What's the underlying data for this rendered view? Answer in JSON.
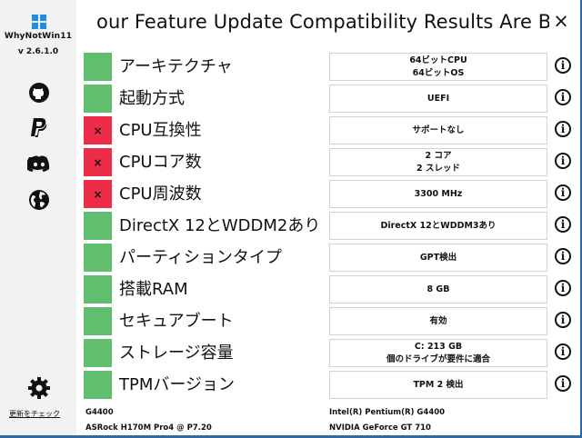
{
  "app": {
    "name": "WhyNotWin11",
    "version": "v 2.6.1.0",
    "update_link": "更新をチェック",
    "brand_color": "#1e8fe6"
  },
  "header": {
    "title": "our Feature Update Compatibility Results Are Belo",
    "close_label": "×"
  },
  "sidebar_icons": [
    "github-icon",
    "paypal-icon",
    "discord-icon",
    "globe-icon",
    "gear-icon"
  ],
  "status_colors": {
    "pass": "#5fbf6e",
    "fail": "#ec2c49"
  },
  "checks": [
    {
      "status": "pass",
      "mark": "",
      "label": "アーキテクチャ",
      "value_lines": [
        "64ビットCPU",
        "64ビットOS"
      ]
    },
    {
      "status": "pass",
      "mark": "",
      "label": "起動方式",
      "value_lines": [
        "UEFI"
      ]
    },
    {
      "status": "fail",
      "mark": "×",
      "label": "CPU互換性",
      "value_lines": [
        "サポートなし"
      ]
    },
    {
      "status": "fail",
      "mark": "×",
      "label": "CPUコア数",
      "value_lines": [
        "2 コア",
        "2 スレッド"
      ]
    },
    {
      "status": "fail",
      "mark": "×",
      "label": "CPU周波数",
      "value_lines": [
        "3300 MHz"
      ]
    },
    {
      "status": "pass",
      "mark": "",
      "label": "DirectX 12とWDDM2あり",
      "value_lines": [
        "DirectX 12とWDDM3あり"
      ]
    },
    {
      "status": "pass",
      "mark": "",
      "label": "パーティションタイプ",
      "value_lines": [
        "GPT検出"
      ]
    },
    {
      "status": "pass",
      "mark": "",
      "label": "搭載RAM",
      "value_lines": [
        "8 GB"
      ]
    },
    {
      "status": "pass",
      "mark": "",
      "label": "セキュアブート",
      "value_lines": [
        "有効"
      ]
    },
    {
      "status": "pass",
      "mark": "",
      "label": "ストレージ容量",
      "value_lines": [
        "C: 213 GB",
        "個のドライブが要件に適合"
      ]
    },
    {
      "status": "pass",
      "mark": "",
      "label": "TPMバージョン",
      "value_lines": [
        "TPM 2 検出"
      ]
    }
  ],
  "info_icon_label": "i",
  "footer": {
    "cpu_short": "G4400",
    "board": "ASRock H170M Pro4 @ P7.20",
    "cpu_full": "Intel(R) Pentium(R) G4400",
    "gpu": "NVIDIA GeForce GT 710"
  }
}
